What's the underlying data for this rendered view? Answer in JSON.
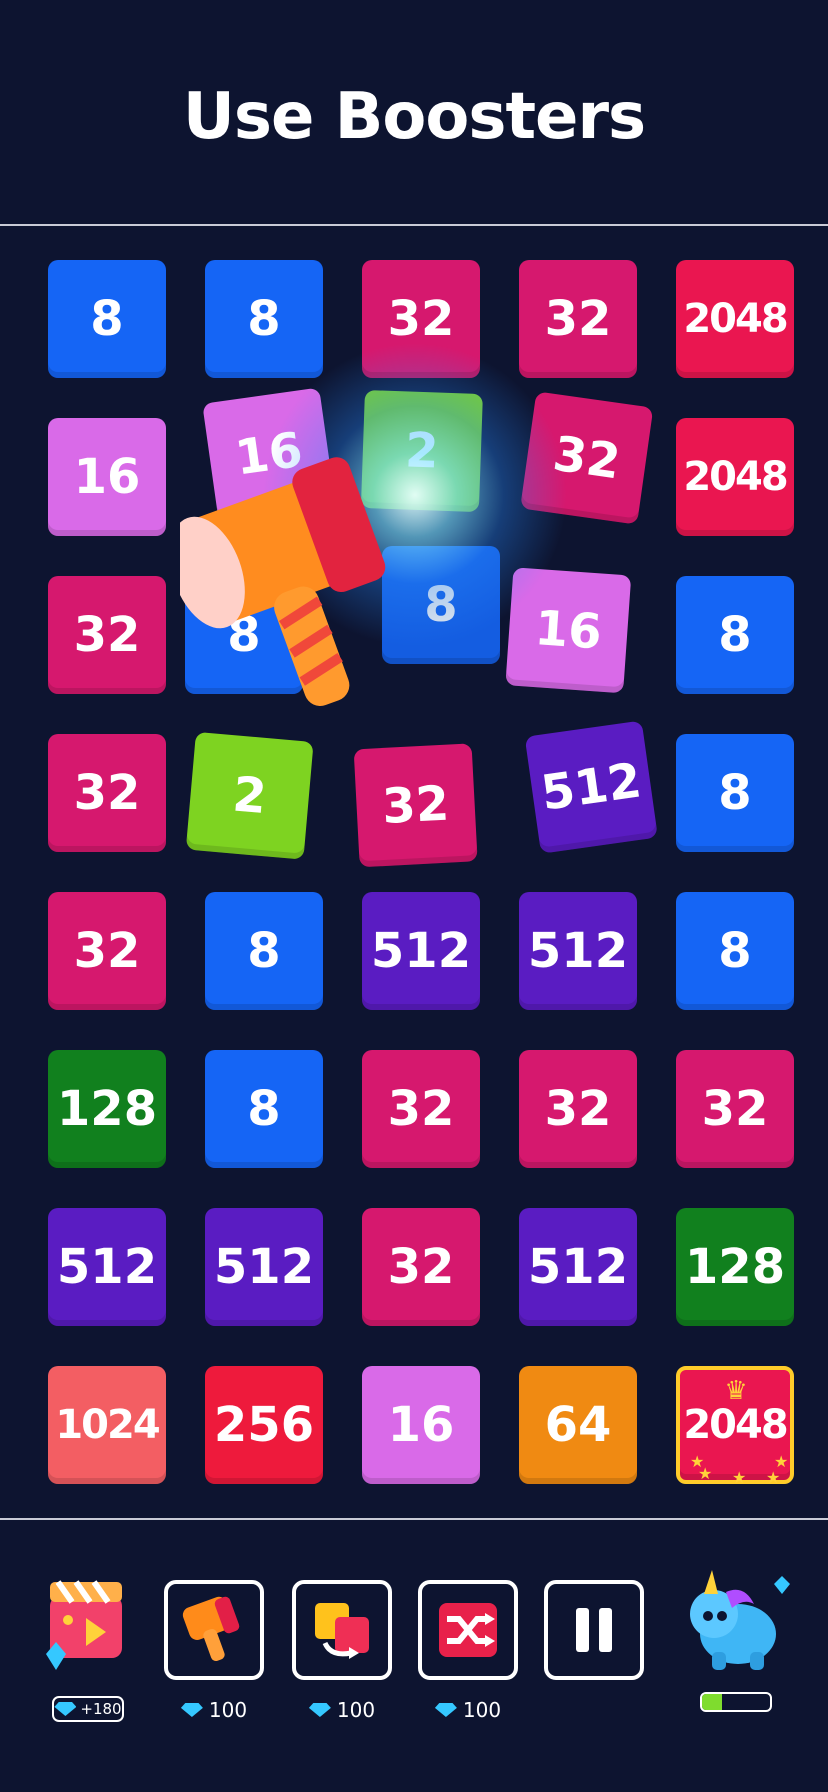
{
  "header": {
    "title": "Use Boosters"
  },
  "colors": {
    "background": "#0d1430",
    "tile_2": "#7ed321",
    "tile_8": "#1565f5",
    "tile_16": "#d96ae8",
    "tile_32": "#d6186e",
    "tile_64": "#f08a12",
    "tile_128": "#11801e",
    "tile_256": "#ee1a3c",
    "tile_512": "#5a1cc2",
    "tile_1024": "#f35e63",
    "tile_2048": "#ea1650"
  },
  "board": {
    "rows": [
      [
        "8",
        "8",
        "32",
        "32",
        "2048"
      ],
      [
        "16",
        "16",
        "2",
        "32",
        "2048"
      ],
      [
        "32",
        "8",
        "8",
        "16",
        "8"
      ],
      [
        "32",
        "2",
        "32",
        "512",
        "8"
      ],
      [
        "32",
        "8",
        "512",
        "512",
        "8"
      ],
      [
        "128",
        "8",
        "32",
        "32",
        "32"
      ],
      [
        "512",
        "512",
        "32",
        "512",
        "128"
      ],
      [
        "1024",
        "256",
        "16",
        "64",
        "2048"
      ]
    ],
    "highlighted_tile": {
      "row": 8,
      "col": 5,
      "icons": [
        "crown-icon",
        "star-icon"
      ]
    },
    "active_booster_icon": "hammer-icon"
  },
  "toolbar": {
    "reward": {
      "icon": "video-reward-icon",
      "label": "+180"
    },
    "boosters": [
      {
        "icon": "hammer-icon",
        "cost": "100"
      },
      {
        "icon": "swap-icon",
        "cost": "100"
      },
      {
        "icon": "shuffle-icon",
        "cost": "100"
      }
    ],
    "pause_icon": "pause-icon",
    "mascot_icon": "unicorn-icon",
    "mascot_progress": 0.3
  }
}
